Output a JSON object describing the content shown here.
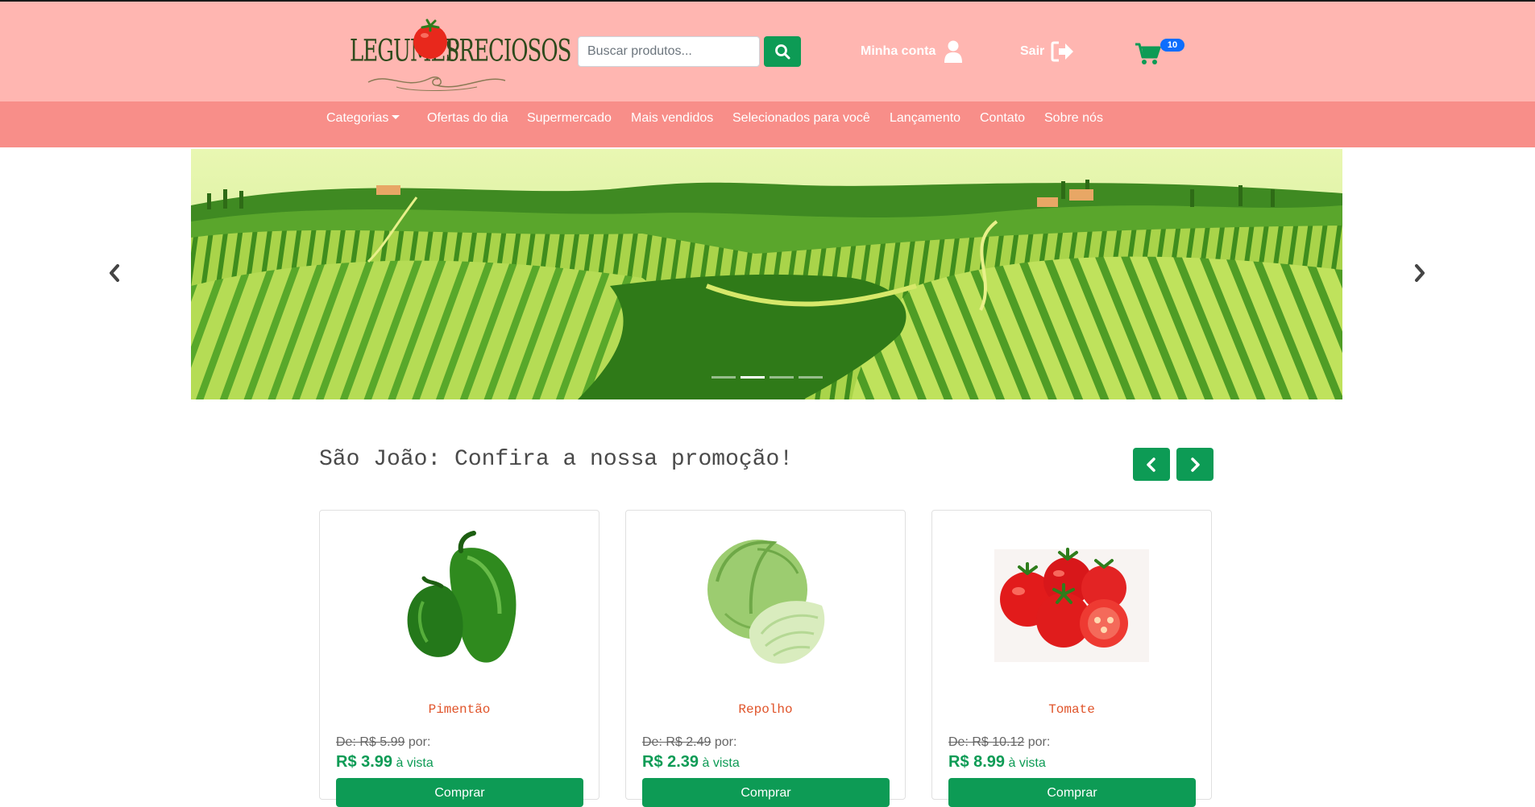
{
  "brand": {
    "word1": "LEGUMES",
    "word2": "PRECIOSOS"
  },
  "search": {
    "placeholder": "Buscar produtos..."
  },
  "header": {
    "account_label": "Minha conta",
    "logout_label": "Sair",
    "cart_count": "10"
  },
  "nav": {
    "items": [
      "Categorias",
      "Ofertas do dia",
      "Supermercado",
      "Mais vendidos",
      "Selecionados para você",
      "Lançamento",
      "Contato",
      "Sobre nós"
    ]
  },
  "carousel": {
    "slides": 4,
    "active_index": 1
  },
  "promo": {
    "title": "São João: Confira a nossa promoção!",
    "products": [
      {
        "name": "Pimentão",
        "old_price_label": "De: R$ 5.99",
        "por": "por:",
        "price": "R$ 3.99",
        "price_note": "à vista",
        "button": "Comprar"
      },
      {
        "name": "Repolho",
        "old_price_label": "De: R$ 2.49",
        "por": "por:",
        "price": "R$ 2.39",
        "price_note": "à vista",
        "button": "Comprar"
      },
      {
        "name": "Tomate",
        "old_price_label": "De: R$ 10.12",
        "por": "por:",
        "price": "R$ 8.99",
        "price_note": "à vista",
        "button": "Comprar"
      }
    ]
  },
  "colors": {
    "header_bg": "#ffb6b1",
    "nav_bg": "#f88e89",
    "accent_green": "#0d9b55",
    "product_name": "#e0542a",
    "badge": "#0d6efd"
  },
  "icons": [
    "tomato-logo-icon",
    "search-icon",
    "user-icon",
    "sign-out-icon",
    "shopping-cart-icon",
    "chevron-left-icon",
    "chevron-right-icon"
  ]
}
